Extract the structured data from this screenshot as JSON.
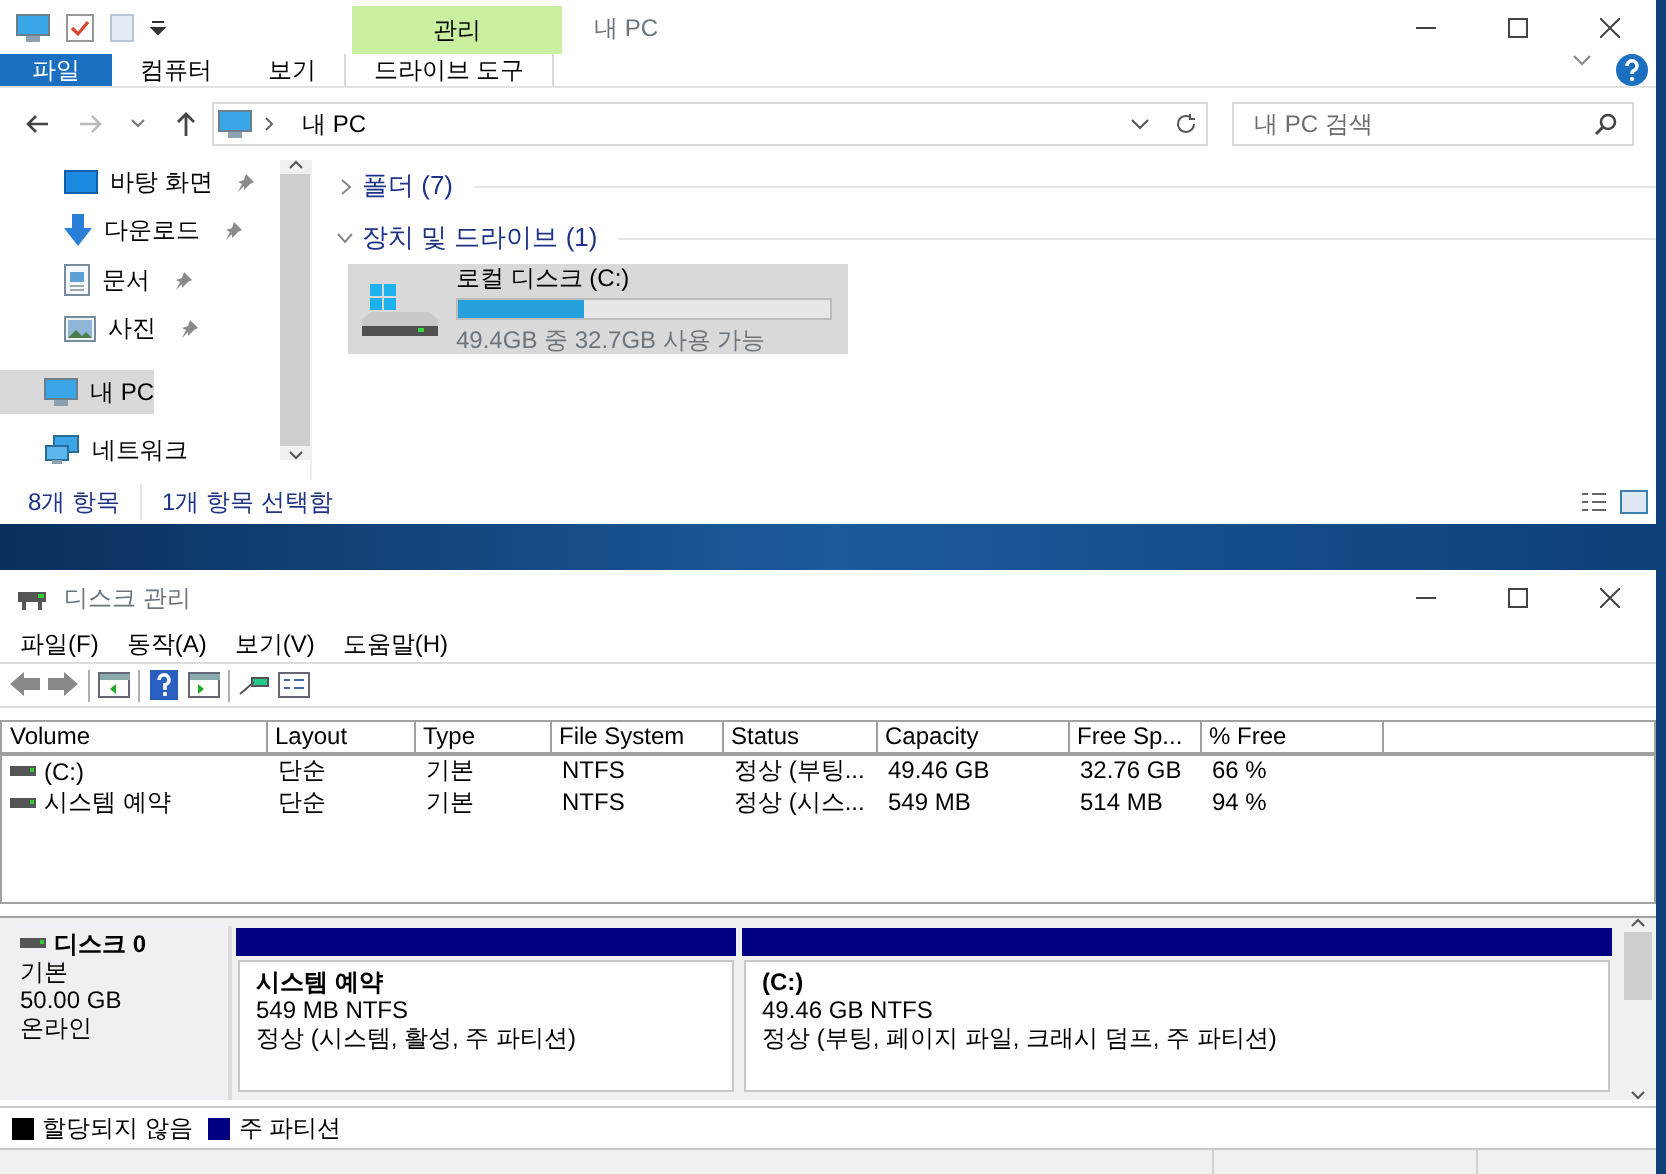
{
  "explorer": {
    "title": "내 PC",
    "contextual_group": "관리",
    "ribbon_tabs": [
      {
        "label": "파일",
        "kind": "file"
      },
      {
        "label": "컴퓨터",
        "kind": "tab"
      },
      {
        "label": "보기",
        "kind": "tab"
      },
      {
        "label": "드라이브 도구",
        "kind": "contextual"
      }
    ],
    "address": "내 PC",
    "search": {
      "placeholder": "내 PC 검색"
    },
    "quick_access": [
      {
        "label": "바탕 화면",
        "pinned": true
      },
      {
        "label": "다운로드",
        "pinned": true
      },
      {
        "label": "문서",
        "pinned": true
      },
      {
        "label": "사진",
        "pinned": true
      }
    ],
    "roots": [
      {
        "label": "내 PC",
        "selected": true
      },
      {
        "label": "네트워크",
        "selected": false
      }
    ],
    "sections": [
      {
        "label": "폴더 (7)",
        "expanded": false
      },
      {
        "label": "장치 및 드라이브 (1)",
        "expanded": true
      }
    ],
    "drive": {
      "name": "로컬 디스크 (C:)",
      "level": 0.34,
      "reading": "49.4GB 중 32.7GB 사용 가능",
      "selected": true
    },
    "status_bar": [
      "8개 항목",
      "1개 항목 선택함"
    ]
  },
  "disk_management": {
    "title": "디스크 관리",
    "menu": [
      "파일(F)",
      "동작(A)",
      "보기(V)",
      "도움말(H)"
    ],
    "table": {
      "columns": [
        "Volume",
        "Layout",
        "Type",
        "File System",
        "Status",
        "Capacity",
        "Free Sp...",
        "% Free"
      ],
      "rows": [
        [
          "(C:)",
          "단순",
          "기본",
          "NTFS",
          "정상 (부팅...",
          "49.46 GB",
          "32.76 GB",
          "66 %"
        ],
        [
          "시스템 예약",
          "단순",
          "기본",
          "NTFS",
          "정상 (시스...",
          "549 MB",
          "514 MB",
          "94 %"
        ]
      ]
    },
    "disk": {
      "name": "디스크 0",
      "type": "기본",
      "size": "50.00 GB",
      "status": "온라인"
    },
    "partitions": [
      {
        "name": "시스템 예약",
        "size": "549 MB NTFS",
        "status": "정상 (시스템, 활성, 주 파티션)",
        "color": "#000080"
      },
      {
        "name": "(C:)",
        "size": "49.46 GB NTFS",
        "status": "정상 (부팅, 페이지 파일, 크래시 덤프, 주 파티션)",
        "color": "#000080"
      }
    ],
    "legend": [
      {
        "label": "할당되지 않음",
        "color": "#000000"
      },
      {
        "label": "주 파티션",
        "color": "#000080"
      }
    ]
  }
}
